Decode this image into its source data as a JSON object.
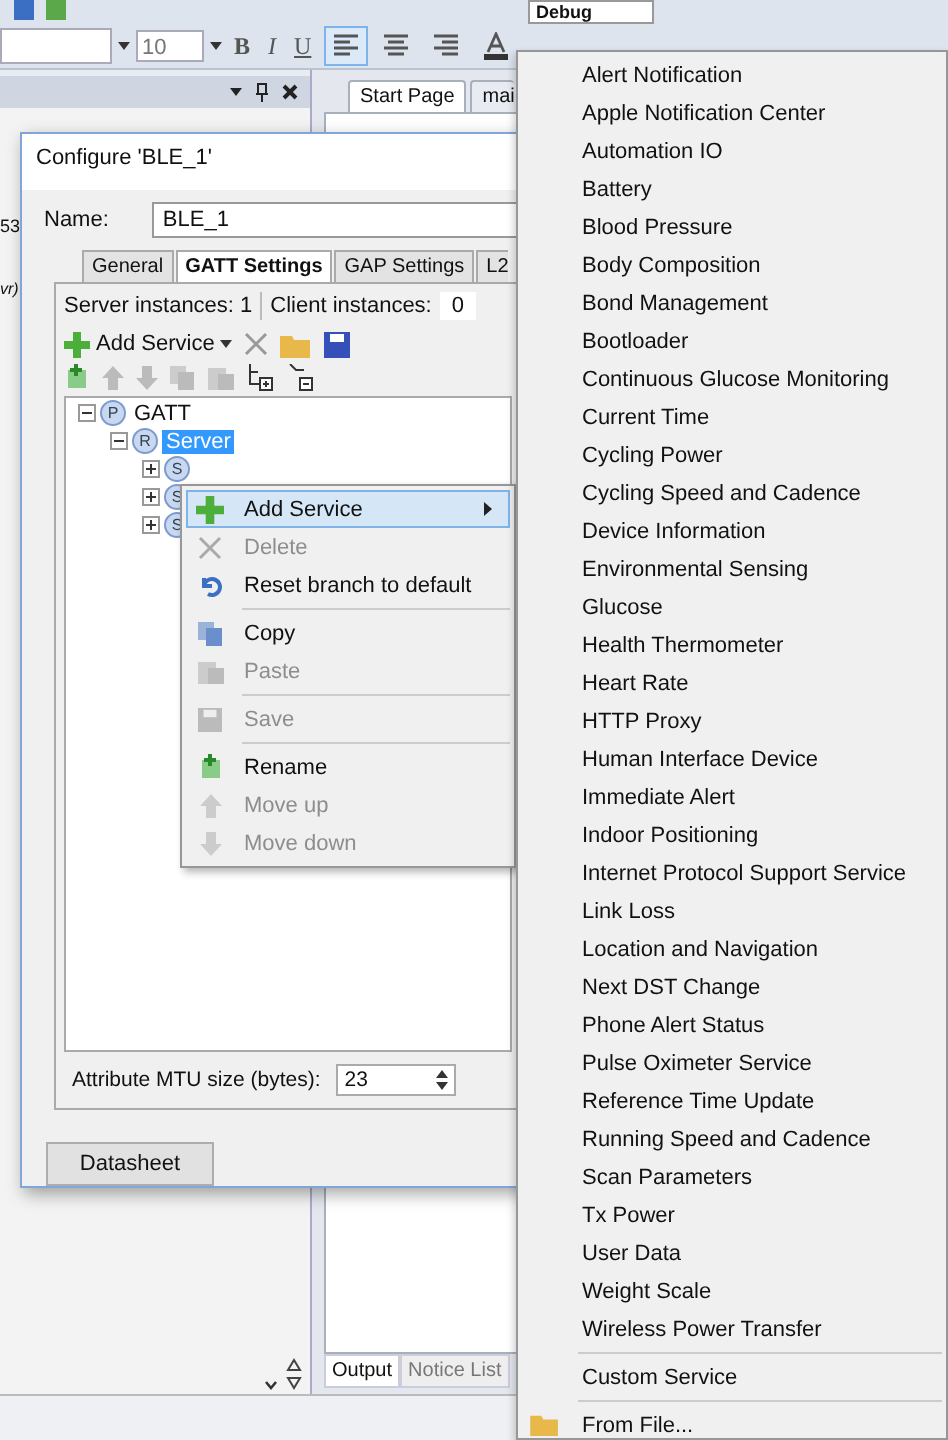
{
  "toolbar": {
    "configuration": "Debug",
    "font_size": "10",
    "format_buttons": [
      "B",
      "I",
      "U"
    ]
  },
  "left_panel": {
    "fragments": [
      "53",
      "vr)"
    ]
  },
  "editor_tabs": [
    {
      "label": "Start Page",
      "selected": true
    },
    {
      "label": "mai",
      "selected": false
    }
  ],
  "dialog": {
    "title": "Configure 'BLE_1'",
    "name_label": "Name:",
    "name_value": "BLE_1",
    "tabs": [
      {
        "label": "General",
        "selected": false
      },
      {
        "label": "GATT Settings",
        "selected": true
      },
      {
        "label": "GAP Settings",
        "selected": false
      },
      {
        "label": "L2",
        "selected": false
      }
    ],
    "server_instances": "Server instances: 1",
    "client_instances_label": "Client instances:",
    "client_instances_value": "0",
    "add_service": "Add Service",
    "tree": [
      {
        "badge": "P",
        "label": "GATT",
        "expanded": true,
        "selected": false,
        "children": [
          {
            "badge": "R",
            "label": "Server",
            "expanded": true,
            "selected": true,
            "children": [
              {
                "badge": "S",
                "expanded": false,
                "selected": false
              },
              {
                "badge": "S",
                "expanded": false,
                "selected": false
              },
              {
                "badge": "S",
                "expanded": false,
                "selected": false
              }
            ]
          }
        ]
      }
    ],
    "mtu_label": "Attribute MTU size (bytes):",
    "mtu_value": "23",
    "datasheet": "Datasheet"
  },
  "context_menu": [
    {
      "kind": "item",
      "label": "Add Service",
      "disabled": false,
      "selected": true,
      "has_submenu": true
    },
    {
      "kind": "item",
      "label": "Delete",
      "disabled": true,
      "selected": false,
      "has_submenu": false
    },
    {
      "kind": "item",
      "label": "Reset branch to default",
      "disabled": false,
      "selected": false,
      "has_submenu": false
    },
    {
      "kind": "separator"
    },
    {
      "kind": "item",
      "label": "Copy",
      "disabled": false,
      "selected": false,
      "has_submenu": false
    },
    {
      "kind": "item",
      "label": "Paste",
      "disabled": true,
      "selected": false,
      "has_submenu": false
    },
    {
      "kind": "separator"
    },
    {
      "kind": "item",
      "label": "Save",
      "disabled": true,
      "selected": false,
      "has_submenu": false
    },
    {
      "kind": "separator"
    },
    {
      "kind": "item",
      "label": "Rename",
      "disabled": false,
      "selected": false,
      "has_submenu": false
    },
    {
      "kind": "item",
      "label": "Move up",
      "disabled": true,
      "selected": false,
      "has_submenu": false
    },
    {
      "kind": "item",
      "label": "Move down",
      "disabled": true,
      "selected": false,
      "has_submenu": false
    }
  ],
  "service_menu": [
    {
      "kind": "service",
      "label": "Alert Notification"
    },
    {
      "kind": "service",
      "label": "Apple Notification Center"
    },
    {
      "kind": "service",
      "label": "Automation IO"
    },
    {
      "kind": "service",
      "label": "Battery"
    },
    {
      "kind": "service",
      "label": "Blood Pressure"
    },
    {
      "kind": "service",
      "label": "Body Composition"
    },
    {
      "kind": "service",
      "label": "Bond Management"
    },
    {
      "kind": "service",
      "label": "Bootloader"
    },
    {
      "kind": "service",
      "label": "Continuous Glucose Monitoring"
    },
    {
      "kind": "service",
      "label": "Current Time"
    },
    {
      "kind": "service",
      "label": "Cycling Power"
    },
    {
      "kind": "service",
      "label": "Cycling Speed and Cadence"
    },
    {
      "kind": "service",
      "label": "Device Information"
    },
    {
      "kind": "service",
      "label": "Environmental Sensing"
    },
    {
      "kind": "service",
      "label": "Glucose"
    },
    {
      "kind": "service",
      "label": "Health Thermometer"
    },
    {
      "kind": "service",
      "label": "Heart Rate"
    },
    {
      "kind": "service",
      "label": "HTTP Proxy"
    },
    {
      "kind": "service",
      "label": "Human Interface Device"
    },
    {
      "kind": "service",
      "label": "Immediate Alert"
    },
    {
      "kind": "service",
      "label": "Indoor Positioning"
    },
    {
      "kind": "service",
      "label": "Internet Protocol Support Service"
    },
    {
      "kind": "service",
      "label": "Link Loss"
    },
    {
      "kind": "service",
      "label": "Location and Navigation"
    },
    {
      "kind": "service",
      "label": "Next DST Change"
    },
    {
      "kind": "service",
      "label": "Phone Alert Status"
    },
    {
      "kind": "service",
      "label": "Pulse Oximeter Service"
    },
    {
      "kind": "service",
      "label": "Reference Time Update"
    },
    {
      "kind": "service",
      "label": "Running Speed and Cadence"
    },
    {
      "kind": "service",
      "label": "Scan Parameters"
    },
    {
      "kind": "service",
      "label": "Tx Power"
    },
    {
      "kind": "service",
      "label": "User Data"
    },
    {
      "kind": "service",
      "label": "Weight Scale"
    },
    {
      "kind": "service",
      "label": "Wireless Power Transfer"
    },
    {
      "kind": "separator"
    },
    {
      "kind": "service",
      "label": "Custom Service"
    },
    {
      "kind": "separator"
    },
    {
      "kind": "file",
      "label": "From File..."
    }
  ],
  "bottom_tabs": [
    {
      "label": "Output",
      "selected": true
    },
    {
      "label": "Notice List",
      "selected": false
    }
  ]
}
